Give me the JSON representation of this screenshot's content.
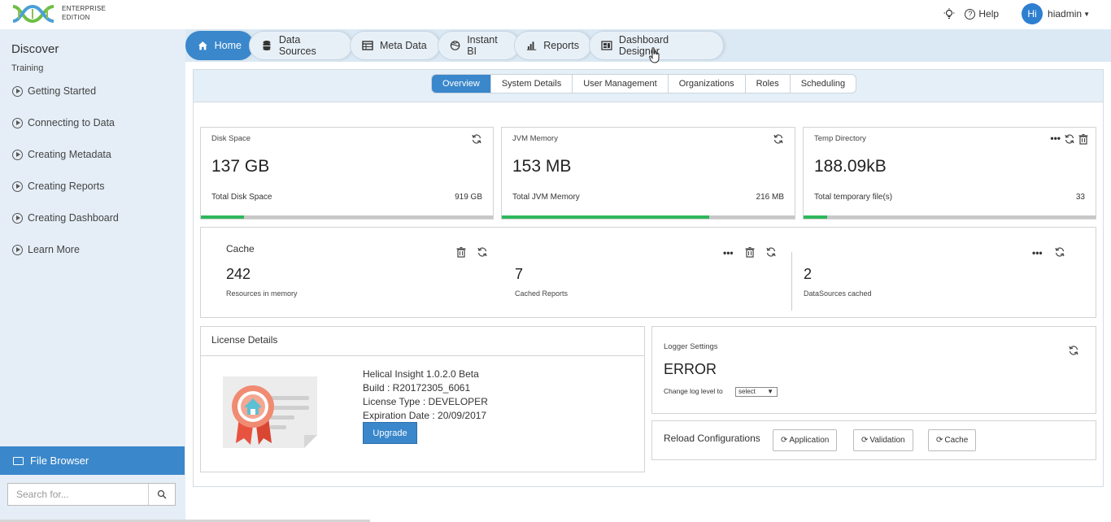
{
  "brand": {
    "line1": "ENTERPRISE",
    "line2": "EDITION",
    "colors": {
      "primary": "#3a87cb",
      "green": "#2eb85c",
      "sidebar": "#e5eef7"
    }
  },
  "header": {
    "help_label": "Help",
    "avatar_initials": "Hi",
    "username": "hiadmin"
  },
  "sidebar": {
    "title": "Discover",
    "section": "Training",
    "items": [
      {
        "label": "Getting Started"
      },
      {
        "label": "Connecting to Data"
      },
      {
        "label": "Creating Metadata"
      },
      {
        "label": "Creating Reports"
      },
      {
        "label": "Creating Dashboard"
      },
      {
        "label": "Learn More"
      }
    ],
    "file_browser_label": "File Browser",
    "search_placeholder": "Search for..."
  },
  "nav": {
    "tabs": [
      {
        "label": "Home",
        "icon": "home-icon",
        "active": true
      },
      {
        "label": "Data Sources",
        "icon": "database-icon"
      },
      {
        "label": "Meta Data",
        "icon": "table-icon"
      },
      {
        "label": "Instant BI",
        "icon": "globe-icon"
      },
      {
        "label": "Reports",
        "icon": "bar-chart-icon"
      },
      {
        "label": "Dashboard Designer",
        "icon": "dashboard-icon"
      }
    ]
  },
  "subnav": {
    "tabs": [
      "Overview",
      "System Details",
      "User Management",
      "Organizations",
      "Roles",
      "Scheduling"
    ],
    "active": "Overview"
  },
  "disk": {
    "title": "Disk Space",
    "value": "137 GB",
    "sub": "Total Disk Space",
    "total": "919 GB",
    "fraction": 0.149
  },
  "jvm": {
    "title": "JVM Memory",
    "value": "153 MB",
    "sub": "Total JVM Memory",
    "total": "216 MB",
    "fraction": 0.708
  },
  "temp": {
    "title": "Temp Directory",
    "value": "188.09kB",
    "sub": "Total temporary file(s)",
    "total": "33",
    "fraction": 0.08
  },
  "cache": {
    "title": "Cache",
    "resources_value": "242",
    "resources_label": "Resources in memory",
    "reports_value": "7",
    "reports_label": "Cached Reports",
    "datasources_value": "2",
    "datasources_label": "DataSources cached"
  },
  "license": {
    "title": "License Details",
    "product": "Helical Insight 1.0.2.0 Beta",
    "build": "Build : R20172305_6061",
    "type": "License Type : DEVELOPER",
    "expiry": "Expiration Date : 20/09/2017",
    "upgrade_label": "Upgrade"
  },
  "logger": {
    "title": "Logger Settings",
    "level": "ERROR",
    "change_label": "Change log level to",
    "select_value": "select"
  },
  "reload": {
    "title": "Reload Configurations",
    "buttons": [
      "Application",
      "Validation",
      "Cache"
    ]
  }
}
